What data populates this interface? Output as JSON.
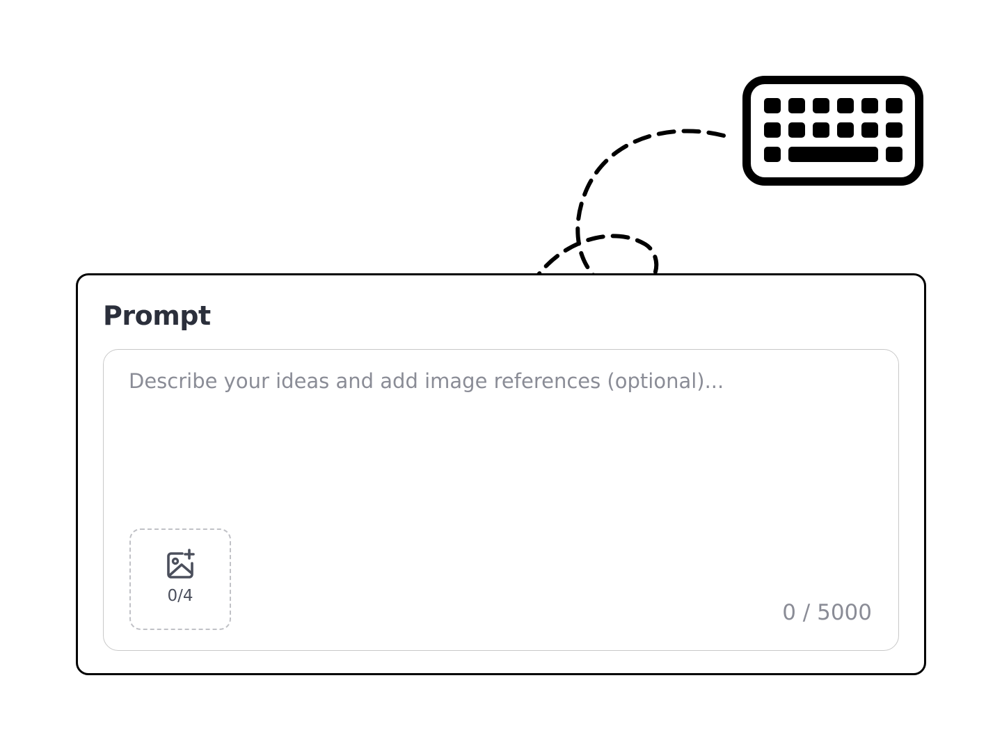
{
  "prompt": {
    "title": "Prompt",
    "placeholder": "Describe your ideas and add image references (optional)...",
    "value": "",
    "image_count": "0/4",
    "char_counter": "0 / 5000"
  },
  "icons": {
    "keyboard": "keyboard-icon",
    "image_add": "image-add-icon",
    "arrow": "dashed-curved-arrow"
  },
  "colors": {
    "title": "#2b2f3b",
    "placeholder": "#8a8c96",
    "border": "#000000",
    "box_border": "#c8c8c8",
    "dashed_border": "#c0c1c6"
  }
}
